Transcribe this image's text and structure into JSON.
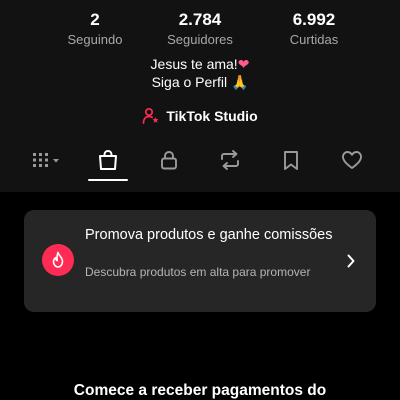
{
  "stats": [
    {
      "value": "2",
      "label": "Seguindo"
    },
    {
      "value": "2.784",
      "label": "Seguidores"
    },
    {
      "value": "6.992",
      "label": "Curtidas"
    }
  ],
  "bio": {
    "line1": "Jesus te ama!",
    "line1_emoji": "❤",
    "line2": "Siga o Perfil",
    "line2_emoji": "🙏"
  },
  "studio": {
    "label": "TikTok Studio",
    "icon": "person-star-icon",
    "icon_color": "#fe2c55"
  },
  "tabs": [
    {
      "name": "grid-menu",
      "icon": "grid-dropdown-icon",
      "active": false
    },
    {
      "name": "shop",
      "icon": "shopping-bag-icon",
      "active": true
    },
    {
      "name": "private",
      "icon": "lock-icon",
      "active": false
    },
    {
      "name": "reposts",
      "icon": "repost-icon",
      "active": false
    },
    {
      "name": "favorites",
      "icon": "bookmark-icon",
      "active": false
    },
    {
      "name": "liked",
      "icon": "heart-outline-icon",
      "active": false
    }
  ],
  "promo": {
    "title": "Promova produtos e ganhe comissões",
    "subtitle": "Descubra produtos em alta para promover",
    "icon": "flame-icon",
    "accent": "#fe2c55"
  },
  "bottom_text": "Comece a receber pagamentos do"
}
